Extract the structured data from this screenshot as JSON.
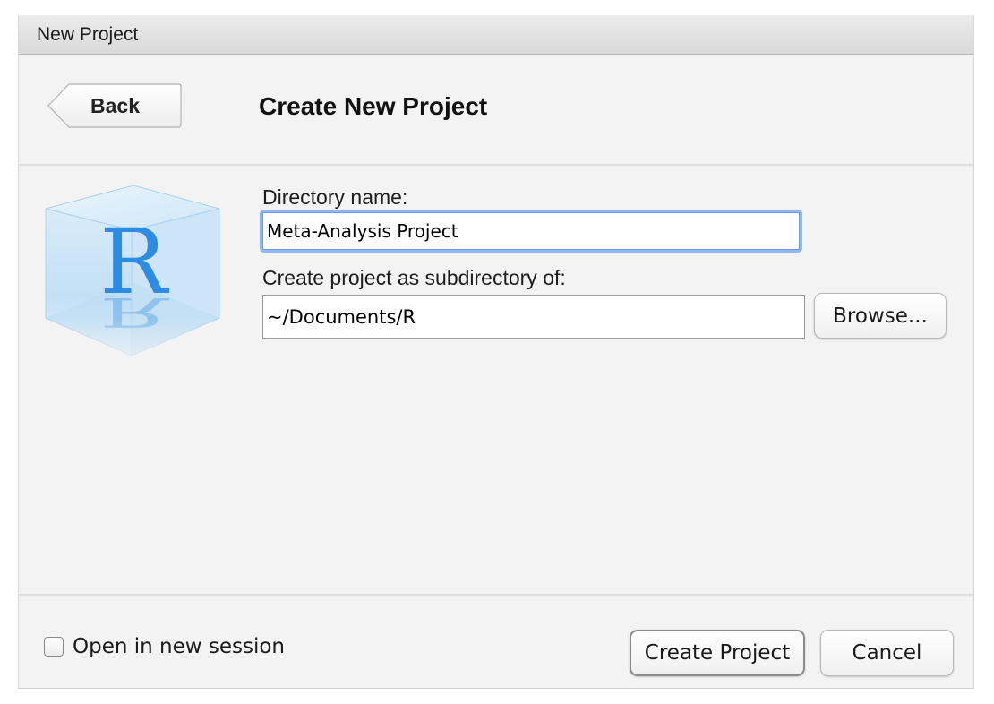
{
  "window": {
    "title": "New Project"
  },
  "header": {
    "back_label": "Back",
    "page_title": "Create New Project"
  },
  "form": {
    "directory_label": "Directory name:",
    "directory_value": "Meta-Analysis Project",
    "parent_label": "Create project as subdirectory of:",
    "parent_value": "~/Documents/R",
    "browse_label": "Browse..."
  },
  "footer": {
    "open_new_session_label": "Open in new session",
    "open_new_session_checked": false,
    "create_label": "Create Project",
    "cancel_label": "Cancel"
  },
  "logo": {
    "letter": "R",
    "icon": "r-cube-logo"
  },
  "colors": {
    "accent": "#6c9de5",
    "r_blue": "#2f8be0",
    "background": "#f2f3f2"
  }
}
